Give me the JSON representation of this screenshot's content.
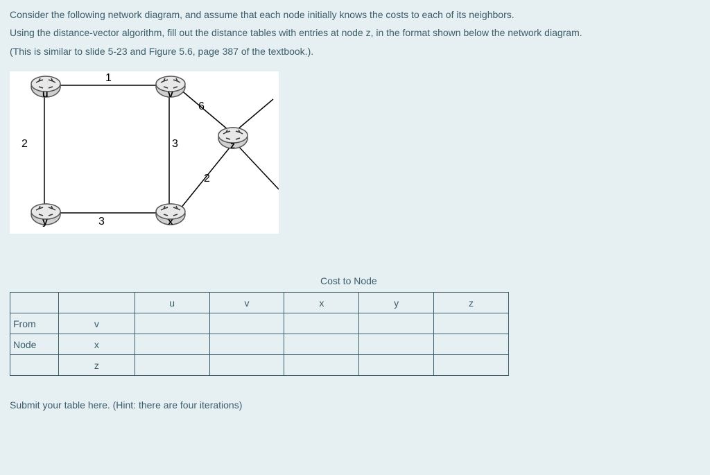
{
  "question": {
    "line1": "Consider the following network diagram, and assume that each node initially knows the costs to each of its neighbors.",
    "line2": "Using the distance-vector algorithm, fill out the distance tables with entries at node z, in the format shown below the network diagram.",
    "line3": "(This is similar to slide 5-23 and Figure 5.6, page 387 of the textbook.)."
  },
  "network": {
    "nodes": {
      "u": "u",
      "v": "v",
      "x": "x",
      "y": "y",
      "z": "z"
    },
    "edges": {
      "uv": "1",
      "uy": "2",
      "vx": "3",
      "yx": "3",
      "vz": "6",
      "xz": "2"
    }
  },
  "table": {
    "cost_title": "Cost to Node",
    "headers": {
      "u": "u",
      "v": "v",
      "x": "x",
      "y": "y",
      "z": "z"
    },
    "row_labels": {
      "from": "From",
      "node": "Node"
    },
    "sub_labels": {
      "v": "v",
      "x": "x",
      "z": "z"
    }
  },
  "hint": "Submit your table here.  (Hint: there are four iterations)"
}
